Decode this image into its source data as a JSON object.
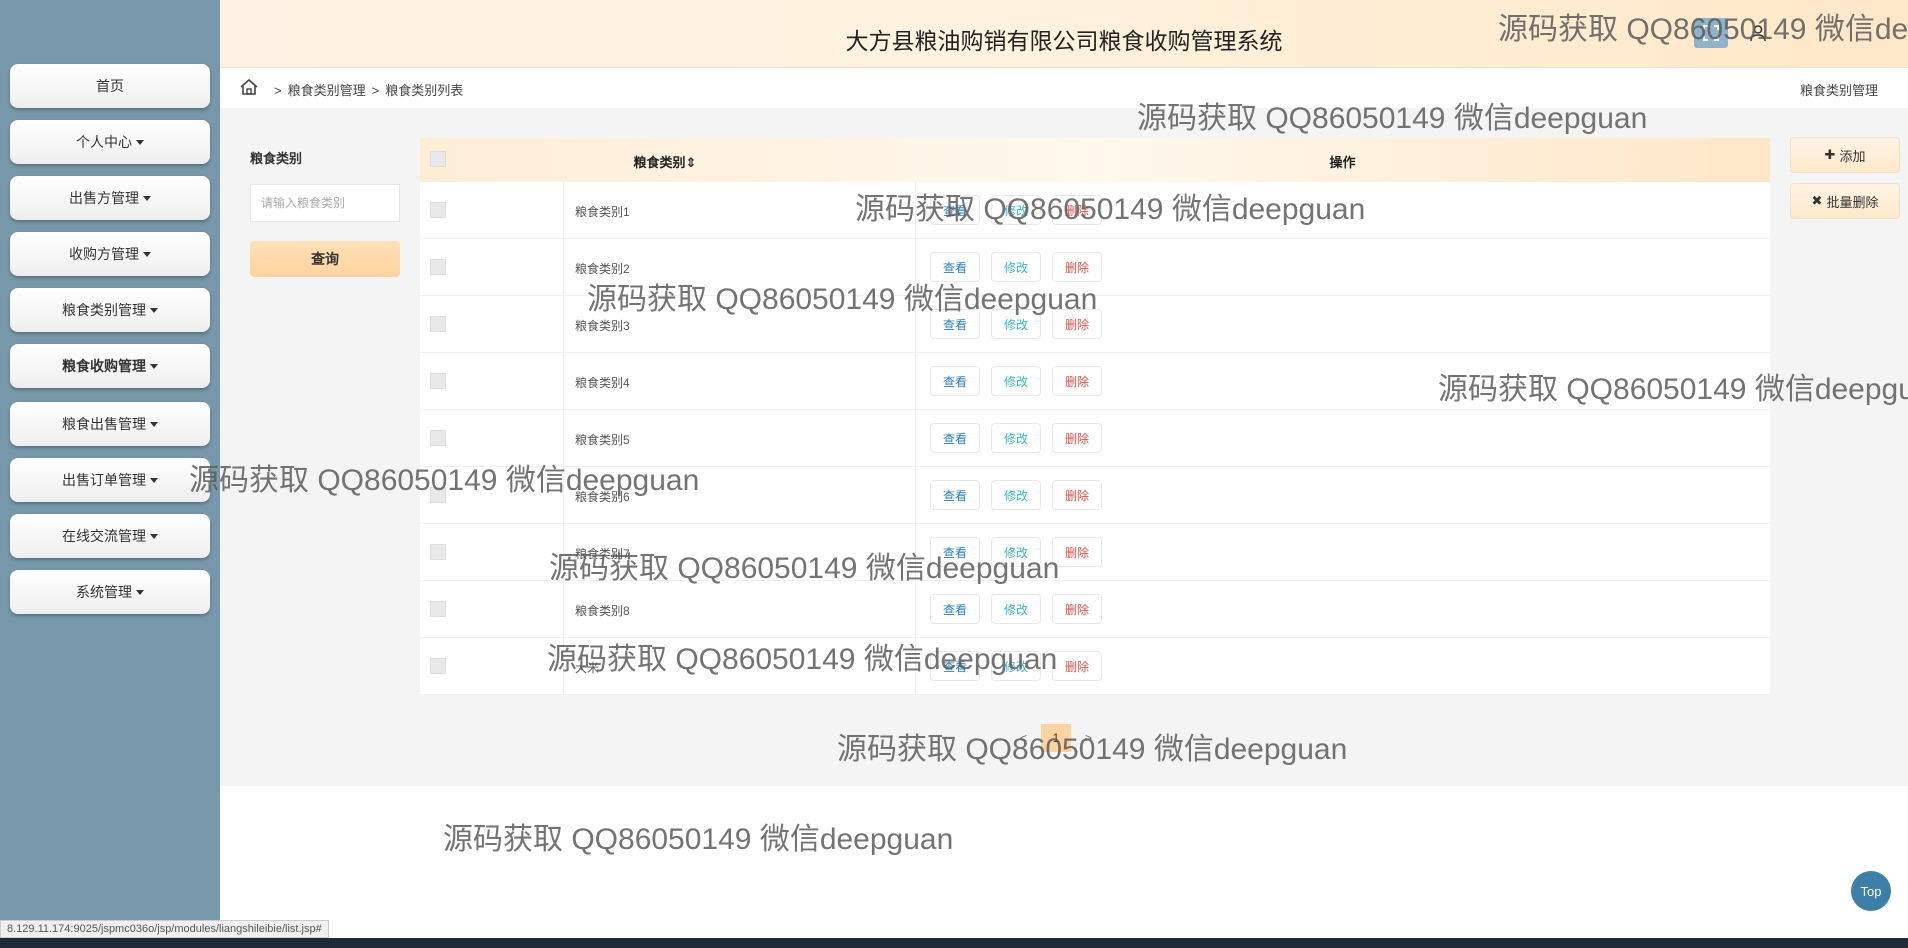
{
  "header": {
    "title": "大方县粮油购销有限公司粮食收购管理系统"
  },
  "sidebar": {
    "items": [
      {
        "label": "首页",
        "caret": false
      },
      {
        "label": "个人中心",
        "caret": true
      },
      {
        "label": "出售方管理",
        "caret": true
      },
      {
        "label": "收购方管理",
        "caret": true
      },
      {
        "label": "粮食类别管理",
        "caret": true
      },
      {
        "label": "粮食收购管理",
        "caret": true
      },
      {
        "label": "粮食出售管理",
        "caret": true
      },
      {
        "label": "出售订单管理",
        "caret": true
      },
      {
        "label": "在线交流管理",
        "caret": true
      },
      {
        "label": "系统管理",
        "caret": true
      }
    ]
  },
  "breadcrumb": {
    "items": [
      "粮食类别管理",
      "粮食类别列表"
    ],
    "separator": ">",
    "right": "粮食类别管理"
  },
  "search": {
    "label": "粮食类别",
    "placeholder": "请输入粮食类别",
    "button": "查询"
  },
  "table": {
    "columns": [
      "粮食类别",
      "操作"
    ],
    "sort_icon": "⇕",
    "rows": [
      {
        "name": "粮食类别1"
      },
      {
        "name": "粮食类别2"
      },
      {
        "name": "粮食类别3"
      },
      {
        "name": "粮食类别4"
      },
      {
        "name": "粮食类别5"
      },
      {
        "name": "粮食类别6"
      },
      {
        "name": "粮食类别7"
      },
      {
        "name": "粮食类别8"
      },
      {
        "name": "大米"
      }
    ],
    "actions": {
      "view": "查看",
      "edit": "修改",
      "delete": "删除"
    }
  },
  "toolbar": {
    "add": "添加",
    "batch_delete": "批量删除"
  },
  "pager": {
    "prev": "<",
    "current": "1",
    "next": ">"
  },
  "top_button": "Top",
  "status_url": "8.129.11.174:9025/jspmc036o/jsp/modules/liangshileibie/list.jsp#",
  "watermark": "源码获取 QQ86050149 微信deepguan",
  "colors": {
    "sidebar": "#7797ab",
    "header_accent": "#ffe8c8",
    "query_button": "#ffd39f",
    "view": "#2c7fb8",
    "edit": "#3bb3c3",
    "delete": "#d9534f"
  }
}
